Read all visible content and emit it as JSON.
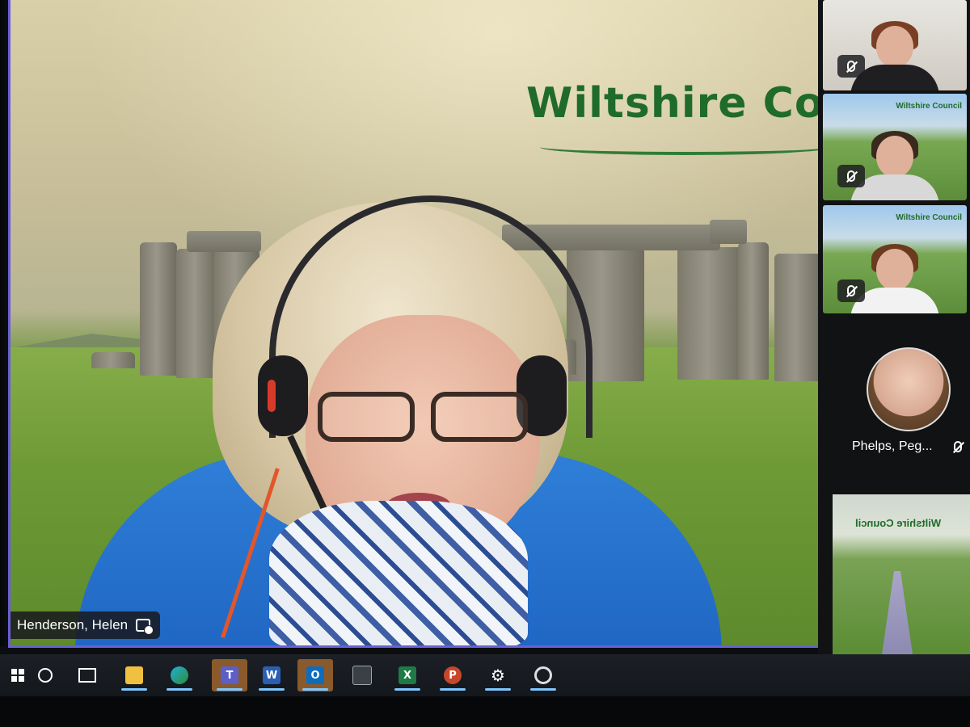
{
  "meeting": {
    "active_speaker": {
      "name": "Henderson, Helen",
      "background_logo": "Wiltshire Cou"
    }
  },
  "gallery": {
    "tiles": [
      {
        "kind": "video",
        "muted": true,
        "background": "room"
      },
      {
        "kind": "video",
        "muted": true,
        "background": "wiltshire",
        "logo": "Wiltshire Council"
      },
      {
        "kind": "video",
        "muted": true,
        "background": "wiltshire",
        "logo": "Wiltshire Council"
      },
      {
        "kind": "avatar",
        "name": "Phelps, Peg...",
        "muted": true
      },
      {
        "kind": "video",
        "background": "wiltshire-mirrored",
        "logo": "Wiltshire Council"
      }
    ]
  },
  "taskbar": {
    "items": [
      {
        "name": "start",
        "icon": "windows-logo-icon"
      },
      {
        "name": "search",
        "icon": "search-icon"
      },
      {
        "name": "task-view",
        "icon": "task-view-icon"
      },
      {
        "name": "file-explorer",
        "icon": "folder-icon",
        "running": true
      },
      {
        "name": "edge",
        "icon": "edge-icon",
        "running": true
      },
      {
        "name": "teams",
        "icon": "teams-icon",
        "running": true,
        "active": true,
        "glyph": "T"
      },
      {
        "name": "word",
        "icon": "word-icon",
        "running": true,
        "glyph": "W"
      },
      {
        "name": "outlook",
        "icon": "outlook-icon",
        "running": true,
        "active": true,
        "glyph": "O"
      },
      {
        "name": "calculator",
        "icon": "calculator-icon"
      },
      {
        "name": "excel",
        "icon": "excel-icon",
        "running": true,
        "glyph": "X"
      },
      {
        "name": "powerpoint",
        "icon": "powerpoint-icon",
        "running": true,
        "glyph": "P"
      },
      {
        "name": "settings",
        "icon": "gear-icon",
        "running": true
      },
      {
        "name": "app",
        "icon": "app-icon",
        "running": true
      }
    ]
  },
  "colors": {
    "stage_border": "#6b5fd6",
    "teams_active": "#8a5a2c",
    "running_indicator": "#7ec6ff",
    "logo_green": "#1f6b2a"
  }
}
